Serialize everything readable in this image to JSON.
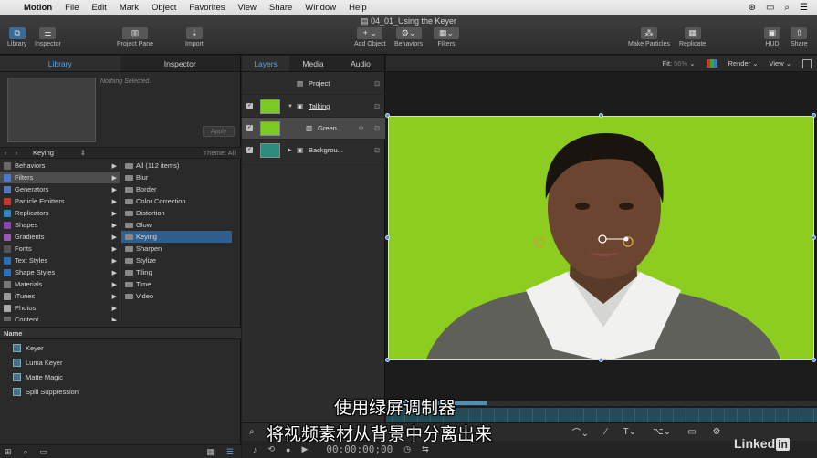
{
  "menubar": {
    "app_name": "Motion",
    "menus": [
      "File",
      "Edit",
      "Mark",
      "Object",
      "Favorites",
      "View",
      "Share",
      "Window",
      "Help"
    ]
  },
  "toolbar": {
    "document_title": "04_01_Using the Keyer",
    "library_label": "Library",
    "inspector_label": "Inspector",
    "project_pane_label": "Project Pane",
    "import_label": "Import",
    "add_object_label": "Add Object",
    "behaviors_label": "Behaviors",
    "filters_label": "Filters",
    "make_particles_label": "Make Particles",
    "replicate_label": "Replicate",
    "hud_label": "HUD",
    "share_label": "Share"
  },
  "library": {
    "tabs": [
      "Library",
      "Inspector"
    ],
    "preview_text": "Nothing Selected.",
    "apply_label": "Apply",
    "path_label": "Keying",
    "theme_label": "Theme: All",
    "categories": [
      {
        "label": "Behaviors",
        "color": "#6a6a6a"
      },
      {
        "label": "Filters",
        "color": "#4b79c9"
      },
      {
        "label": "Generators",
        "color": "#5577bb"
      },
      {
        "label": "Particle Emitters",
        "color": "#c0392b"
      },
      {
        "label": "Replicators",
        "color": "#2e86c1"
      },
      {
        "label": "Shapes",
        "color": "#8e44ad"
      },
      {
        "label": "Gradients",
        "color": "#9b59b6"
      },
      {
        "label": "Fonts",
        "color": "#555555"
      },
      {
        "label": "Text Styles",
        "color": "#2c6fbb"
      },
      {
        "label": "Shape Styles",
        "color": "#2c6fbb"
      },
      {
        "label": "Materials",
        "color": "#777777"
      },
      {
        "label": "iTunes",
        "color": "#999999"
      },
      {
        "label": "Photos",
        "color": "#aaaaaa"
      },
      {
        "label": "Content",
        "color": "#666666"
      }
    ],
    "subcategories": [
      "All (112 items)",
      "Blur",
      "Border",
      "Color Correction",
      "Distortion",
      "Glow",
      "Keying",
      "Sharpen",
      "Stylize",
      "Tiling",
      "Time",
      "Video"
    ],
    "list_header": "Name",
    "items": [
      "Keyer",
      "Luma Keyer",
      "Matte Magic",
      "Spill Suppression"
    ]
  },
  "layers": {
    "tabs": [
      "Layers",
      "Media",
      "Audio"
    ],
    "project_label": "Project",
    "rows": [
      {
        "name": "Talking"
      },
      {
        "name": "Green..."
      },
      {
        "name": "Backgrou..."
      }
    ]
  },
  "canvas": {
    "fit_label": "Fit:",
    "fit_value": "56%",
    "render_label": "Render",
    "view_label": "View"
  },
  "transport": {
    "timecode": "00:00:00;00"
  },
  "subtitles": {
    "line1": "使用绿屏调制器",
    "line2": "将视频素材从背景中分离出来"
  },
  "watermark": {
    "text": "Linked",
    "suffix": "in"
  }
}
